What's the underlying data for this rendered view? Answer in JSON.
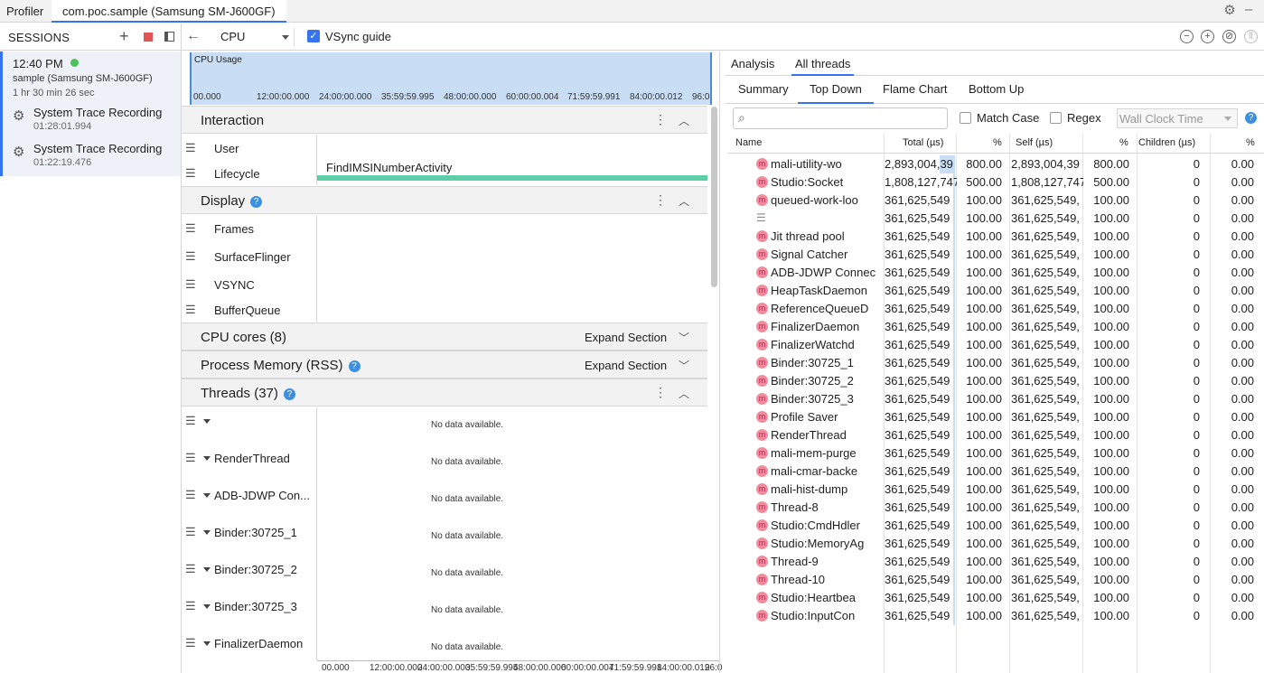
{
  "top_tabs": {
    "profiler": "Profiler",
    "app": "com.poc.sample (Samsung SM-J600GF)"
  },
  "sessions": {
    "title": "SESSIONS",
    "current": {
      "time": "12:40 PM",
      "device": "sample (Samsung SM-J600GF)",
      "duration": "1 hr 30 min 26 sec"
    },
    "recordings": [
      {
        "name": "System Trace Recording",
        "duration": "01:28:01.994"
      },
      {
        "name": "System Trace Recording",
        "duration": "01:22:19.476"
      }
    ]
  },
  "toolbar": {
    "profiler_select": "CPU",
    "vsync_label": "VSync guide",
    "vsync_checked": true
  },
  "cpu_usage": {
    "label": "CPU Usage",
    "ticks": [
      "00.000",
      "12:00:00.000",
      "24:00:00.000",
      "35:59:59.995",
      "48:00:00.000",
      "60:00:00.004",
      "71:59:59.991",
      "84:00:00.012",
      "96:0"
    ]
  },
  "sections": {
    "interaction": {
      "title": "Interaction",
      "tracks": [
        "User",
        "Lifecycle"
      ],
      "event": "FindIMSINumberActivity"
    },
    "display": {
      "title": "Display",
      "tracks": [
        "Frames",
        "SurfaceFlinger",
        "VSYNC",
        "BufferQueue"
      ]
    },
    "cpu_cores": {
      "title": "CPU cores (8)",
      "expand": "Expand Section"
    },
    "memory": {
      "title": "Process Memory (RSS)",
      "expand": "Expand Section"
    },
    "threads": {
      "title": "Threads (37)",
      "tracks": [
        "",
        "RenderThread",
        "ADB-JDWP Con...",
        "Binder:30725_1",
        "Binder:30725_2",
        "Binder:30725_3",
        "FinalizerDaemon"
      ],
      "no_data": "No data available."
    }
  },
  "bottom_ticks": [
    "00.000",
    "12:00:00.000",
    "24:00:00.000",
    "35:59:59.995",
    "48:00:00.000",
    "60:00:00.004",
    "71:59:59.991",
    "84:00:00.012",
    "96:0"
  ],
  "analysis": {
    "tabs": [
      "Analysis",
      "All threads"
    ],
    "subtabs": [
      "Summary",
      "Top Down",
      "Flame Chart",
      "Bottom Up"
    ],
    "match_case": "Match Case",
    "regex": "Regex",
    "clock": "Wall Clock Time",
    "columns": [
      "Name",
      "Total (µs)",
      "%",
      "Self (µs)",
      "%",
      "Children (µs)",
      "%"
    ],
    "rows": [
      {
        "name": "mali-utility-wo",
        "total": "2,893,004,39",
        "tp": "800.00",
        "self": "2,893,004,39",
        "sp": "800.00",
        "children": "0",
        "cp": "0.00"
      },
      {
        "name": "Studio:Socket",
        "total": "1,808,127,747",
        "tp": "500.00",
        "self": "1,808,127,747",
        "sp": "500.00",
        "children": "0",
        "cp": "0.00"
      },
      {
        "name": "queued-work-loo",
        "total": "361,625,549",
        "tp": "100.00",
        "self": "361,625,549,",
        "sp": "100.00",
        "children": "0",
        "cp": "0.00"
      },
      {
        "name": "",
        "total": "361,625,549",
        "tp": "100.00",
        "self": "361,625,549,",
        "sp": "100.00",
        "children": "0",
        "cp": "0.00"
      },
      {
        "name": "Jit thread pool",
        "total": "361,625,549",
        "tp": "100.00",
        "self": "361,625,549,",
        "sp": "100.00",
        "children": "0",
        "cp": "0.00"
      },
      {
        "name": "Signal Catcher",
        "total": "361,625,549",
        "tp": "100.00",
        "self": "361,625,549,",
        "sp": "100.00",
        "children": "0",
        "cp": "0.00"
      },
      {
        "name": "ADB-JDWP Connec",
        "total": "361,625,549",
        "tp": "100.00",
        "self": "361,625,549,",
        "sp": "100.00",
        "children": "0",
        "cp": "0.00"
      },
      {
        "name": "HeapTaskDaemon",
        "total": "361,625,549",
        "tp": "100.00",
        "self": "361,625,549,",
        "sp": "100.00",
        "children": "0",
        "cp": "0.00"
      },
      {
        "name": "ReferenceQueueD",
        "total": "361,625,549",
        "tp": "100.00",
        "self": "361,625,549,",
        "sp": "100.00",
        "children": "0",
        "cp": "0.00"
      },
      {
        "name": "FinalizerDaemon",
        "total": "361,625,549",
        "tp": "100.00",
        "self": "361,625,549,",
        "sp": "100.00",
        "children": "0",
        "cp": "0.00"
      },
      {
        "name": "FinalizerWatchd",
        "total": "361,625,549",
        "tp": "100.00",
        "self": "361,625,549,",
        "sp": "100.00",
        "children": "0",
        "cp": "0.00"
      },
      {
        "name": "Binder:30725_1",
        "total": "361,625,549",
        "tp": "100.00",
        "self": "361,625,549,",
        "sp": "100.00",
        "children": "0",
        "cp": "0.00"
      },
      {
        "name": "Binder:30725_2",
        "total": "361,625,549",
        "tp": "100.00",
        "self": "361,625,549,",
        "sp": "100.00",
        "children": "0",
        "cp": "0.00"
      },
      {
        "name": "Binder:30725_3",
        "total": "361,625,549",
        "tp": "100.00",
        "self": "361,625,549,",
        "sp": "100.00",
        "children": "0",
        "cp": "0.00"
      },
      {
        "name": "Profile Saver",
        "total": "361,625,549",
        "tp": "100.00",
        "self": "361,625,549,",
        "sp": "100.00",
        "children": "0",
        "cp": "0.00"
      },
      {
        "name": "RenderThread",
        "total": "361,625,549",
        "tp": "100.00",
        "self": "361,625,549,",
        "sp": "100.00",
        "children": "0",
        "cp": "0.00"
      },
      {
        "name": "mali-mem-purge",
        "total": "361,625,549",
        "tp": "100.00",
        "self": "361,625,549,",
        "sp": "100.00",
        "children": "0",
        "cp": "0.00"
      },
      {
        "name": "mali-cmar-backe",
        "total": "361,625,549",
        "tp": "100.00",
        "self": "361,625,549,",
        "sp": "100.00",
        "children": "0",
        "cp": "0.00"
      },
      {
        "name": "mali-hist-dump",
        "total": "361,625,549",
        "tp": "100.00",
        "self": "361,625,549,",
        "sp": "100.00",
        "children": "0",
        "cp": "0.00"
      },
      {
        "name": "Thread-8",
        "total": "361,625,549",
        "tp": "100.00",
        "self": "361,625,549,",
        "sp": "100.00",
        "children": "0",
        "cp": "0.00"
      },
      {
        "name": "Studio:CmdHdler",
        "total": "361,625,549",
        "tp": "100.00",
        "self": "361,625,549,",
        "sp": "100.00",
        "children": "0",
        "cp": "0.00"
      },
      {
        "name": "Studio:MemoryAg",
        "total": "361,625,549",
        "tp": "100.00",
        "self": "361,625,549,",
        "sp": "100.00",
        "children": "0",
        "cp": "0.00"
      },
      {
        "name": "Thread-9",
        "total": "361,625,549",
        "tp": "100.00",
        "self": "361,625,549,",
        "sp": "100.00",
        "children": "0",
        "cp": "0.00"
      },
      {
        "name": "Thread-10",
        "total": "361,625,549",
        "tp": "100.00",
        "self": "361,625,549,",
        "sp": "100.00",
        "children": "0",
        "cp": "0.00"
      },
      {
        "name": "Studio:Heartbea",
        "total": "361,625,549",
        "tp": "100.00",
        "self": "361,625,549,",
        "sp": "100.00",
        "children": "0",
        "cp": "0.00"
      },
      {
        "name": "Studio:InputCon",
        "total": "361,625,549",
        "tp": "100.00",
        "self": "361,625,549,",
        "sp": "100.00",
        "children": "0",
        "cp": "0.00"
      }
    ]
  }
}
